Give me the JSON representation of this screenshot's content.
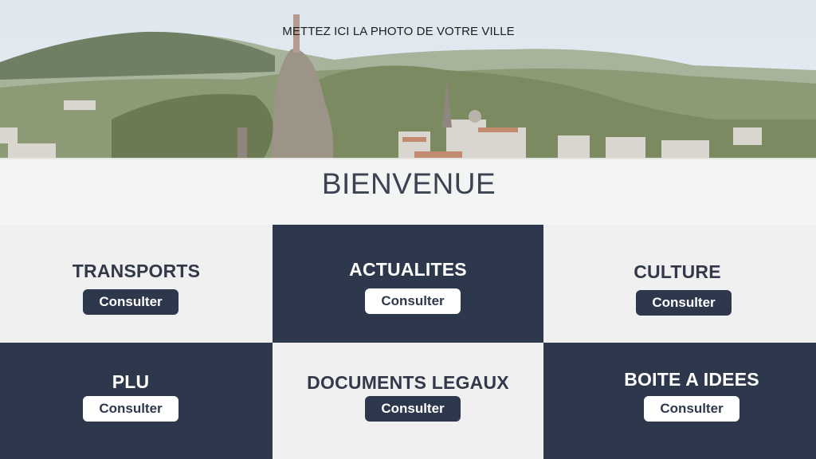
{
  "hero": {
    "caption": "METTEZ ICI LA PHOTO DE VOTRE VILLE",
    "welcome": "BIENVENUE"
  },
  "colors": {
    "dark": "#2e384c",
    "light": "#f0f0f0"
  },
  "tiles": [
    {
      "title": "TRANSPORTS",
      "button": "Consulter"
    },
    {
      "title": "ACTUALITES",
      "button": "Consulter"
    },
    {
      "title": "CULTURE",
      "button": "Consulter"
    },
    {
      "title": "PLU",
      "button": "Consulter"
    },
    {
      "title": "DOCUMENTS LEGAUX",
      "button": "Consulter"
    },
    {
      "title": "BOITE A IDEES",
      "button": "Consulter"
    }
  ]
}
